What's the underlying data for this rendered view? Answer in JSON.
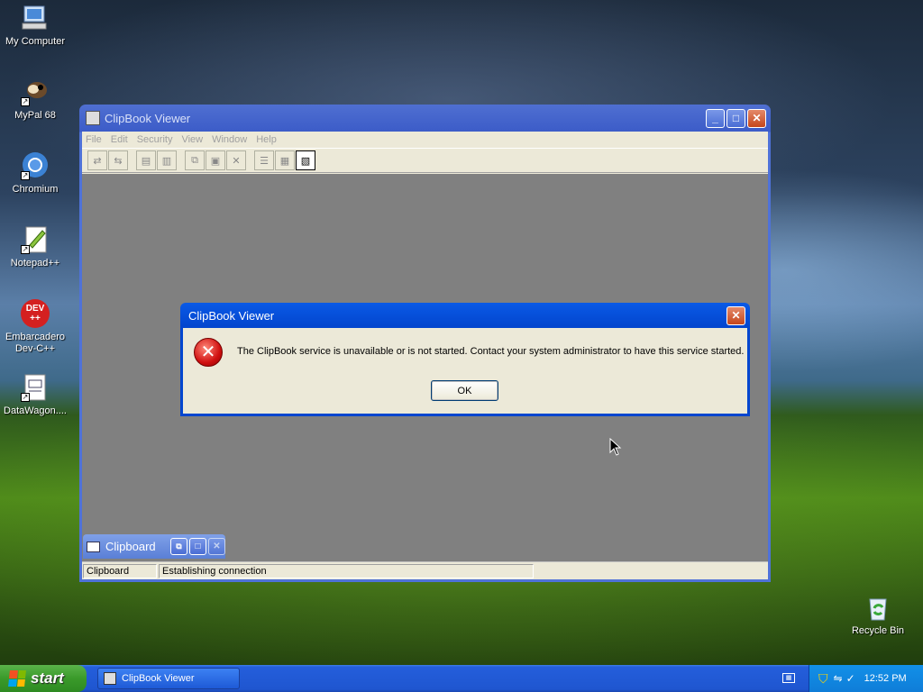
{
  "desktop": {
    "icons": [
      {
        "label": "My Computer",
        "icon": "computer-icon"
      },
      {
        "label": "MyPal 68",
        "icon": "mypal-icon"
      },
      {
        "label": "Chromium",
        "icon": "chromium-icon"
      },
      {
        "label": "Notepad++",
        "icon": "notepadpp-icon"
      },
      {
        "label": "Embarcadero Dev-C++",
        "icon": "devcpp-icon",
        "icon_text": "DEV ++"
      },
      {
        "label": "DataWagon....",
        "icon": "datawagon-icon"
      },
      {
        "label": "Recycle Bin",
        "icon": "recycle-bin-icon"
      }
    ]
  },
  "window": {
    "title": "ClipBook Viewer",
    "menu": [
      "File",
      "Edit",
      "Security",
      "View",
      "Window",
      "Help"
    ],
    "toolbar_icons": [
      "connect-icon",
      "disconnect-icon",
      "share-icon",
      "stop-sharing-icon",
      "copy-icon",
      "paste-icon",
      "delete-icon",
      "table-of-contents-icon",
      "thumbnails-icon",
      "full-page-icon"
    ],
    "minimized_child": {
      "title": "Clipboard"
    },
    "status": {
      "pane1": "Clipboard",
      "pane2": "Establishing connection"
    }
  },
  "dialog": {
    "title": "ClipBook Viewer",
    "message": "The ClipBook service is unavailable or is not started. Contact your system administrator to have this service started.",
    "ok_label": "OK",
    "error_icon_text": "✕"
  },
  "taskbar": {
    "start_label": "start",
    "task_label": "ClipBook Viewer",
    "clock": "12:52 PM"
  },
  "colors": {
    "xp_blue": "#0346cf",
    "window_face": "#ece9d8",
    "client_gray": "#808080",
    "start_green": "#3a9a2a"
  }
}
